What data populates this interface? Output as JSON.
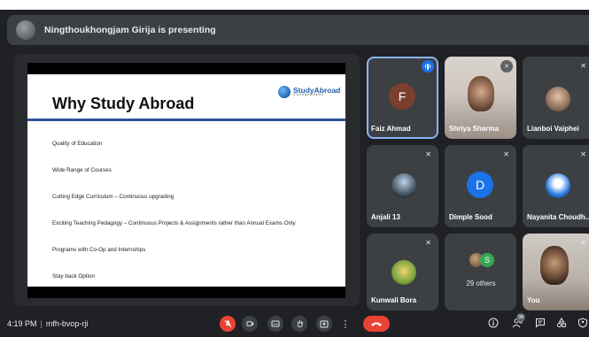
{
  "presenting": {
    "text": "Ningthoukhongjam Girija is presenting"
  },
  "slide": {
    "title": "Why Study Abroad",
    "logo_main": "StudyAbroad",
    "logo_sub": "CollegeDekho",
    "bullets": [
      "Quality of Education",
      "Wide Range of Courses",
      "Cutting Edge Curriculum – Continuous upgrading",
      "Exciting Teaching Pedagogy – Continuous Projects & Assignments rather than Annual Exams Only",
      "Programs with Co-Op and Internships",
      "Stay back Option"
    ]
  },
  "participants": [
    {
      "name": "Faiz Ahmad",
      "initial": "F",
      "avatar_color": "#7b3f2e"
    },
    {
      "name": "Shriya Sharma"
    },
    {
      "name": "Lianboi Vaiphei"
    },
    {
      "name": "Anjali 13"
    },
    {
      "name": "Dimple Sood",
      "initial": "D",
      "avatar_color": "#1a73e8"
    },
    {
      "name": "Nayanita Choudh..."
    },
    {
      "name": "Kunwali Bora"
    },
    {
      "name": "29 others",
      "initial": "S"
    },
    {
      "name": "You"
    }
  ],
  "bottom": {
    "time": "4:19 PM",
    "meeting_code": "mfh-bvop-rji",
    "people_count": "38"
  },
  "icons": {
    "mic_off": "mic-off-icon",
    "camera": "camera-icon",
    "captions": "captions-icon",
    "raise_hand": "raise-hand-icon",
    "present": "present-icon",
    "more": "more-options-icon",
    "end_call": "end-call-icon",
    "info": "info-icon",
    "people": "people-icon",
    "chat": "chat-icon",
    "activities": "activities-icon",
    "host_controls": "host-controls-icon"
  }
}
